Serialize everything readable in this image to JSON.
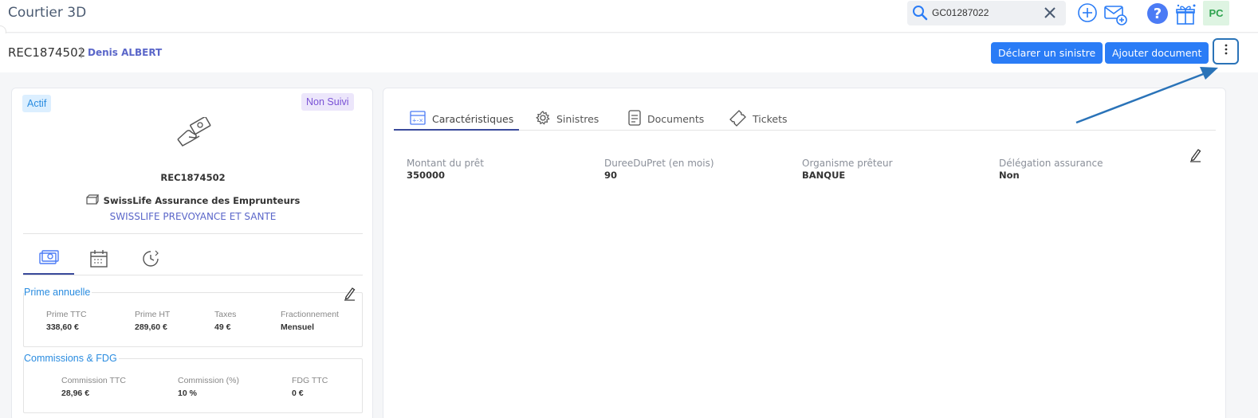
{
  "app": {
    "title": "Courtier 3D"
  },
  "search": {
    "value": "GC01287022"
  },
  "user": {
    "initials": "PC"
  },
  "header": {
    "reference": "REC1874502",
    "separator": "|",
    "client_name": "Denis ALBERT",
    "declare_button": "Déclarer un sinistre",
    "add_doc_button": "Ajouter document"
  },
  "contract": {
    "status": "Actif",
    "follow_status": "Non Suivi",
    "reference": "REC1874502",
    "product": "SwissLife Assurance des Emprunteurs",
    "insurer": "SWISSLIFE PREVOYANCE ET SANTE"
  },
  "prime": {
    "title": "Prime annuelle",
    "items": [
      {
        "label": "Prime TTC",
        "value": "338,60 €"
      },
      {
        "label": "Prime HT",
        "value": "289,60 €"
      },
      {
        "label": "Taxes",
        "value": "49 €"
      },
      {
        "label": "Fractionnement",
        "value": "Mensuel"
      }
    ]
  },
  "commissions": {
    "title": "Commissions & FDG",
    "items": [
      {
        "label": "Commission TTC",
        "value": "28,96 €"
      },
      {
        "label": "Commission (%)",
        "value": "10 %"
      },
      {
        "label": "FDG TTC",
        "value": "0 €"
      }
    ]
  },
  "tabs": [
    {
      "label": "Caractéristiques",
      "icon": "calculator-icon"
    },
    {
      "label": "Sinistres",
      "icon": "gear-icon"
    },
    {
      "label": "Documents",
      "icon": "document-icon"
    },
    {
      "label": "Tickets",
      "icon": "ticket-icon"
    }
  ],
  "fields": [
    {
      "label": "Montant du prêt",
      "value": "350000"
    },
    {
      "label": "DureeDuPret (en mois)",
      "value": "90"
    },
    {
      "label": "Organisme prêteur",
      "value": "BANQUE"
    },
    {
      "label": "Délégation assurance",
      "value": "Non"
    }
  ],
  "colors": {
    "primary": "#2a7cf6",
    "accent_purple": "#5a66c9",
    "annotation": "#2a73b8"
  }
}
